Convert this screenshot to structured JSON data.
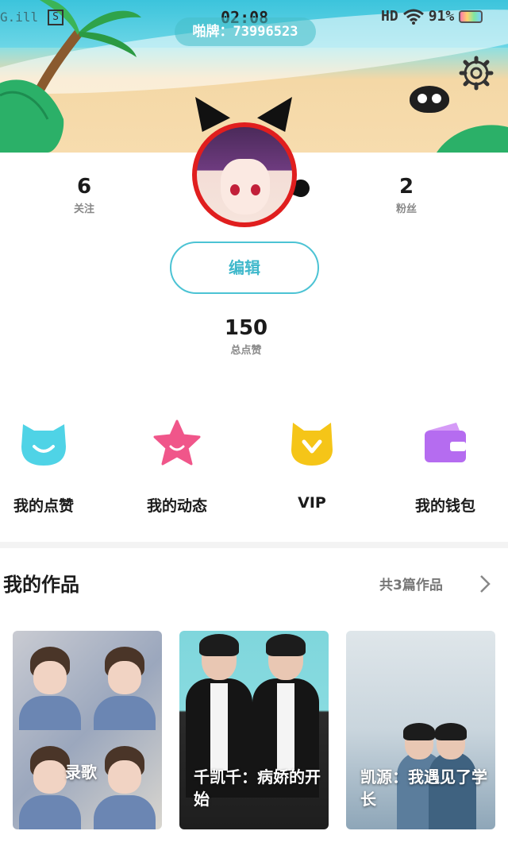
{
  "status_bar": {
    "signal": "G.ill",
    "s_badge": "S",
    "time": "02:08",
    "hd": "HD",
    "battery": "91%"
  },
  "profile": {
    "id_label": "啪牌：73996523",
    "follow_count": "6",
    "follow_label": "关注",
    "fans_count": "2",
    "fans_label": "粉丝",
    "edit_label": "编辑",
    "likes_count": "150",
    "likes_label": "总点赞"
  },
  "actions": [
    {
      "label": "我的点赞",
      "icon": "cat-face-icon",
      "color": "#4fd3e6"
    },
    {
      "label": "我的动态",
      "icon": "star-icon",
      "color": "#f0568a"
    },
    {
      "label": "VIP",
      "icon": "vip-badge-icon",
      "color": "#f5c518"
    },
    {
      "label": "我的钱包",
      "icon": "wallet-icon",
      "color": "#b56cf0"
    }
  ],
  "works": {
    "title": "我的作品",
    "count_label": "共3篇作品",
    "items": [
      {
        "caption": "录歌"
      },
      {
        "caption": "千凯千：病娇的开始"
      },
      {
        "caption": "凯源：我遇见了学长"
      }
    ]
  },
  "colors": {
    "accent": "#4cc3d4",
    "avatar_ring": "#e01e1e"
  }
}
